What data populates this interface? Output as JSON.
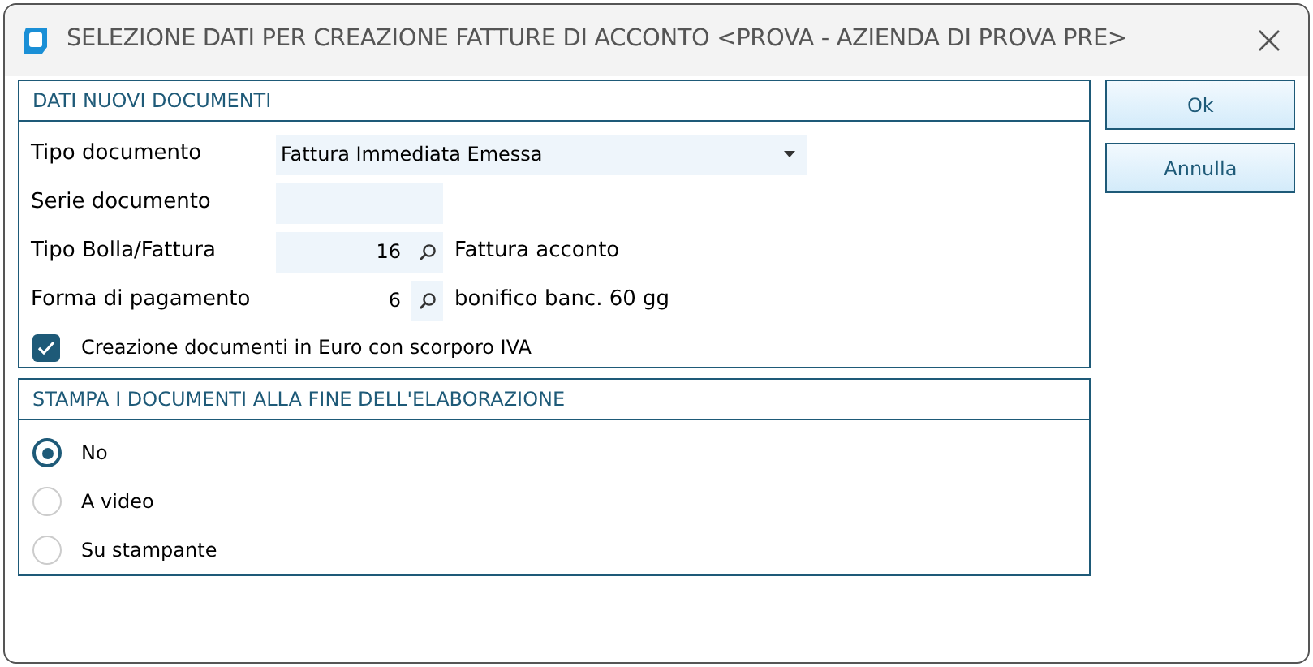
{
  "window": {
    "title": "SELEZIONE DATI PER CREAZIONE FATTURE DI ACCONTO <PROVA - AZIENDA DI PROVA PRE>"
  },
  "documents": {
    "title": "DATI NUOVI DOCUMENTI",
    "fields": [
      {
        "kind": "dropdown",
        "label": "Tipo documento",
        "value": "Fattura Immediata Emessa"
      },
      {
        "kind": "text",
        "label": "Serie documento"
      },
      {
        "kind": "lookup",
        "label": "Tipo Bolla/Fattura",
        "value": "16",
        "description": "Fattura acconto",
        "filled": true
      },
      {
        "kind": "lookup",
        "label": "Forma di pagamento",
        "value": "6",
        "description": "bonifico banc. 60 gg",
        "filled": false
      }
    ],
    "checkbox": {
      "label": "Creazione documenti in Euro con scorporo IVA",
      "checked": true
    }
  },
  "print": {
    "title": "STAMPA I DOCUMENTI ALLA FINE DELL'ELABORAZIONE",
    "options": [
      {
        "label": "No",
        "selected": true
      },
      {
        "label": "A video",
        "selected": false
      },
      {
        "label": "Su stampante",
        "selected": false
      }
    ]
  },
  "buttons": [
    "Ok",
    "Annulla"
  ]
}
